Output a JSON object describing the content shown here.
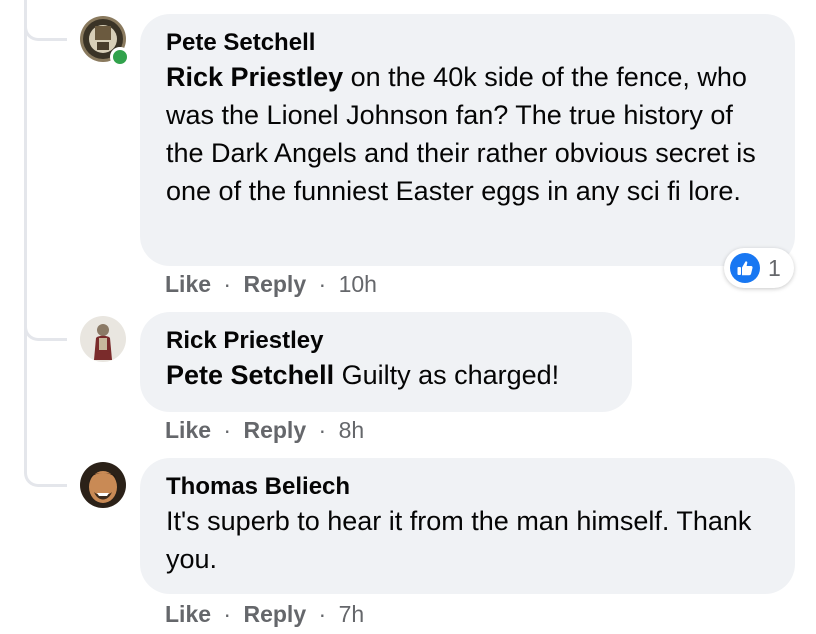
{
  "comments": [
    {
      "author": "Pete Setchell",
      "mention": "Rick Priestley",
      "text": " on the 40k side of the fence, who was the Lionel Johnson fan? The true history of the Dark Angels and their rather obvious secret is one of the funniest Easter eggs in any sci fi lore.",
      "like_label": "Like",
      "separator": "·",
      "reply_label": "Reply",
      "time": "10h",
      "reaction": {
        "icon": "thumbs-up-icon",
        "count": "1"
      },
      "online": true
    },
    {
      "author": "Rick Priestley",
      "mention": "Pete Setchell",
      "text": " Guilty as charged!",
      "like_label": "Like",
      "separator": "·",
      "reply_label": "Reply",
      "time": "8h"
    },
    {
      "author": "Thomas Beliech",
      "text": "It's superb to hear it from the man himself. Thank you.",
      "like_label": "Like",
      "separator": "·",
      "reply_label": "Reply",
      "time": "7h"
    }
  ],
  "colors": {
    "bubble": "#f0f2f5",
    "secondary_text": "#65676b",
    "like_blue": "#1877f2",
    "online_green": "#31a24c",
    "thread_line": "#e4e6eb"
  }
}
